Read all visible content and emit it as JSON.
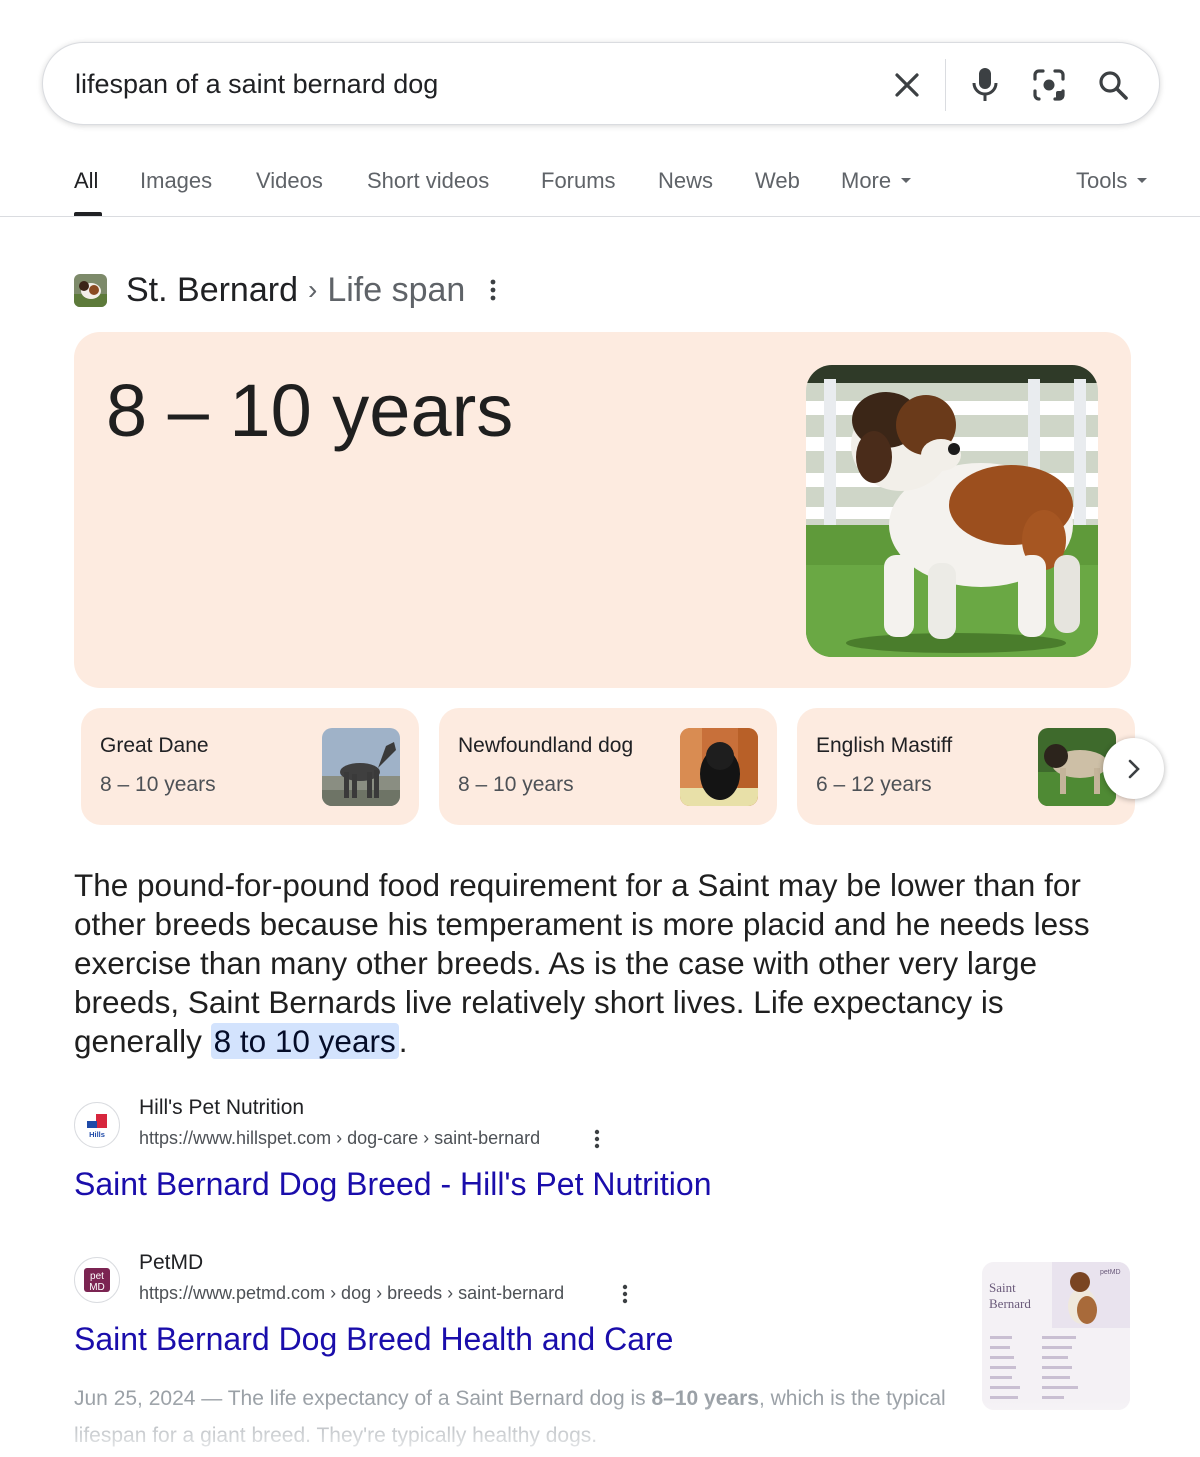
{
  "search": {
    "query": "lifespan of a saint bernard dog",
    "icons": [
      "close-icon",
      "microphone-icon",
      "lens-icon",
      "search-icon"
    ]
  },
  "tabs": [
    {
      "label": "All",
      "active": true
    },
    {
      "label": "Images"
    },
    {
      "label": "Videos"
    },
    {
      "label": "Short videos"
    },
    {
      "label": "Forums"
    },
    {
      "label": "News"
    },
    {
      "label": "Web"
    },
    {
      "label": "More"
    }
  ],
  "tools_label": "Tools",
  "breadcrumb": {
    "entity": "St. Bernard",
    "separator": "›",
    "attribute": "Life span"
  },
  "answer": {
    "value": "8 – 10 years"
  },
  "related": [
    {
      "name": "Great Dane",
      "value": "8 – 10 years"
    },
    {
      "name": "Newfoundland dog",
      "value": "8 – 10 years"
    },
    {
      "name": "English Mastiff",
      "value": "6 – 12 years"
    }
  ],
  "snippet": {
    "before": "The pound-for-pound food requirement for a Saint may be lower than for other breeds because his temperament is more placid and he needs less exercise than many other breeds. As is the case with other very large breeds, Saint Bernards live relatively short lives. Life expectancy is generally ",
    "highlight": "8 to 10 years",
    "after": "."
  },
  "results": [
    {
      "site": "Hill's Pet Nutrition",
      "url": "https://www.hillspet.com › dog-care › saint-bernard",
      "title": "Saint Bernard Dog Breed - Hill's Pet Nutrition",
      "favicon_text": "Hills"
    },
    {
      "site": "PetMD",
      "url": "https://www.petmd.com › dog › breeds › saint-bernard",
      "title": "Saint Bernard Dog Breed Health and Care",
      "favicon_text": "pet MD",
      "date": "Jun 25, 2024",
      "desc_pre": " — The life expectancy of a Saint Bernard dog is ",
      "desc_bold": "8–10 years",
      "desc_post": ", which is the typical lifespan for a giant breed. They're typically healthy dogs.",
      "thumb_title": "Saint Bernard",
      "thumb_brand": "petMD"
    }
  ],
  "colors": {
    "card_bg": "#fdebe0",
    "link": "#1a0dab",
    "highlight": "#d3e3fd"
  }
}
